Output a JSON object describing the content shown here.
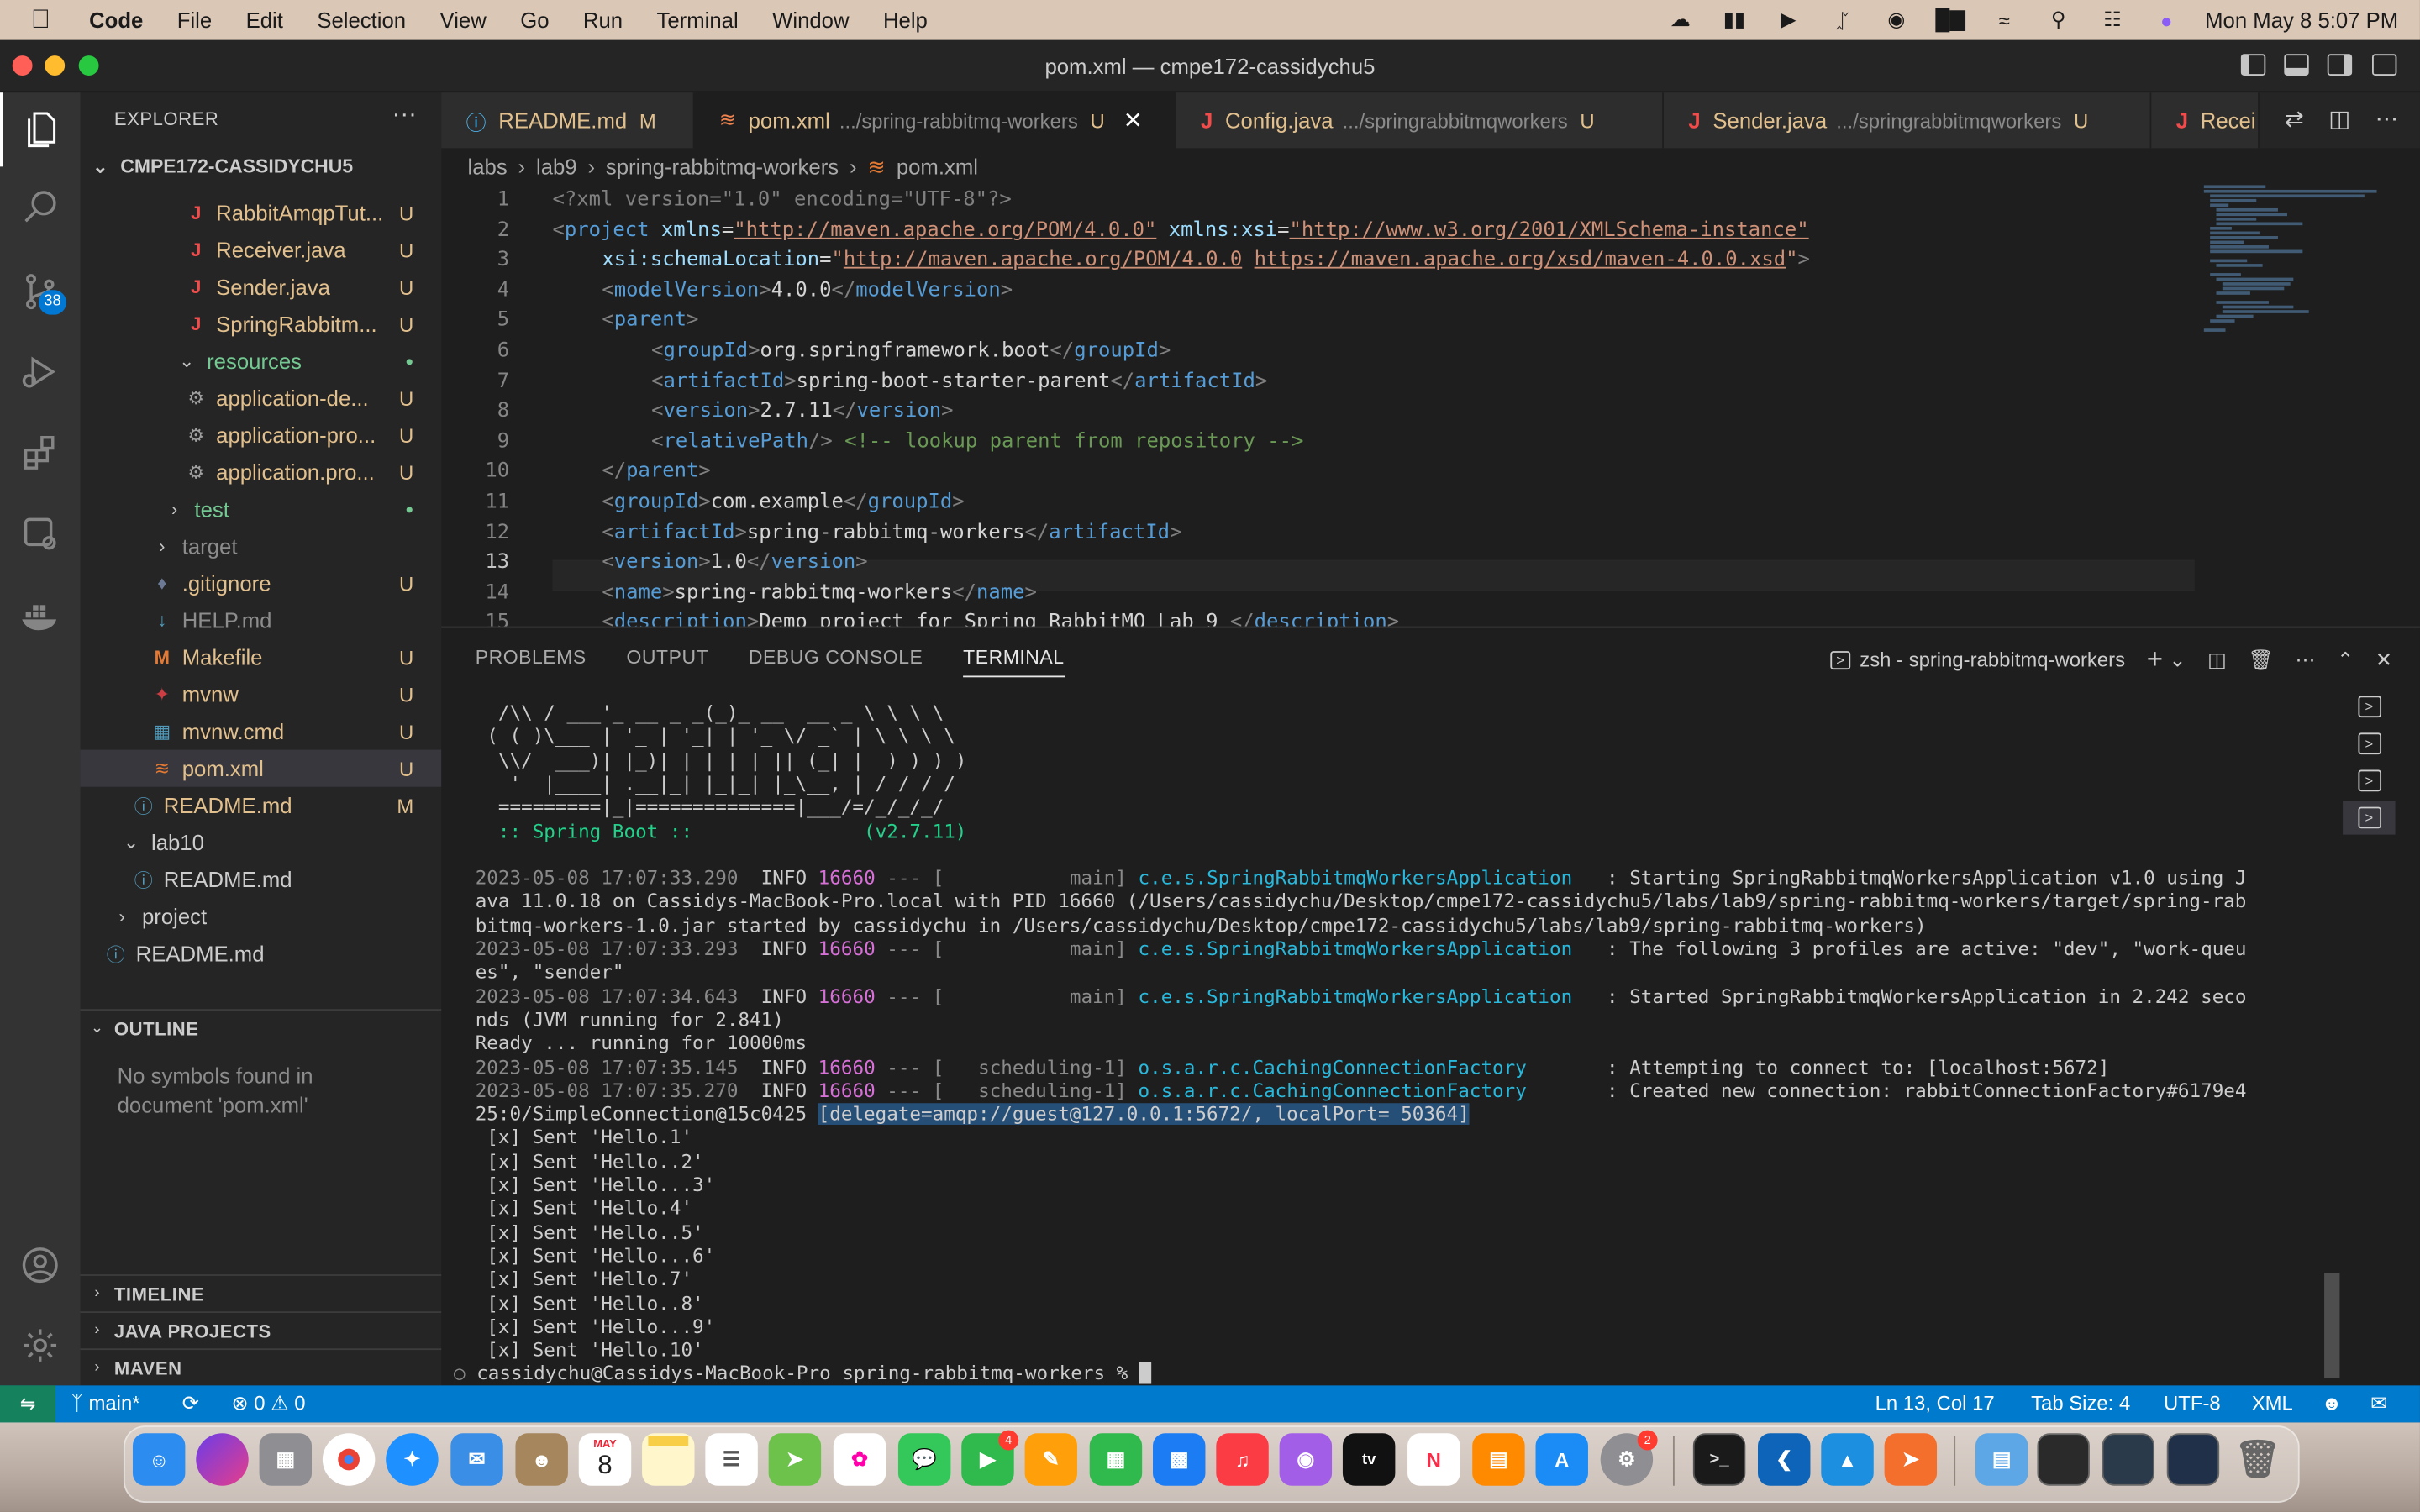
{
  "menubar": {
    "app": "Code",
    "items": [
      "File",
      "Edit",
      "Selection",
      "View",
      "Go",
      "Run",
      "Terminal",
      "Window",
      "Help"
    ],
    "datetime": "Mon May 8  5:07 PM"
  },
  "window": {
    "title": "pom.xml — cmpe172-cassidychu5"
  },
  "activity": {
    "scm_badge": "38"
  },
  "explorer": {
    "header": "EXPLORER",
    "more": "···",
    "root": "CMPE172-CASSIDYCHU5",
    "items": [
      {
        "label": "RabbitAmqpTut...",
        "badge": "U"
      },
      {
        "label": "Receiver.java",
        "badge": "U"
      },
      {
        "label": "Sender.java",
        "badge": "U"
      },
      {
        "label": "SpringRabbitm...",
        "badge": "U"
      },
      {
        "label": "resources",
        "badge": "●"
      },
      {
        "label": "application-de...",
        "badge": "U"
      },
      {
        "label": "application-pro...",
        "badge": "U"
      },
      {
        "label": "application.pro...",
        "badge": "U"
      },
      {
        "label": "test",
        "badge": "●"
      },
      {
        "label": "target",
        "badge": ""
      },
      {
        "label": ".gitignore",
        "badge": "U"
      },
      {
        "label": "HELP.md",
        "badge": ""
      },
      {
        "label": "Makefile",
        "badge": "U"
      },
      {
        "label": "mvnw",
        "badge": "U"
      },
      {
        "label": "mvnw.cmd",
        "badge": "U"
      },
      {
        "label": "pom.xml",
        "badge": "U"
      },
      {
        "label": "README.md",
        "badge": "M"
      },
      {
        "label": "lab10",
        "badge": ""
      },
      {
        "label": "README.md",
        "badge": ""
      },
      {
        "label": "project",
        "badge": ""
      },
      {
        "label": "README.md",
        "badge": ""
      }
    ],
    "outline_title": "OUTLINE",
    "outline_empty": "No symbols found in document 'pom.xml'",
    "timeline": "TIMELINE",
    "java_projects": "JAVA PROJECTS",
    "maven": "MAVEN"
  },
  "tabs": [
    {
      "name": "README.md",
      "path": "",
      "status": "M"
    },
    {
      "name": "pom.xml",
      "path": ".../spring-rabbitmq-workers",
      "status": "U"
    },
    {
      "name": "Config.java",
      "path": ".../springrabbitmqworkers",
      "status": "U"
    },
    {
      "name": "Sender.java",
      "path": ".../springrabbitmqworkers",
      "status": "U"
    },
    {
      "name": "Recei",
      "path": "",
      "status": ""
    }
  ],
  "breadcrumb": [
    "labs",
    "lab9",
    "spring-rabbitmq-workers",
    "pom.xml"
  ],
  "code_lines": [
    "1",
    "2",
    "3",
    "4",
    "5",
    "6",
    "7",
    "8",
    "9",
    "10",
    "11",
    "12",
    "13",
    "14",
    "15"
  ],
  "code": {
    "l1": [
      "<?xml version=\"1.0\" encoding=\"UTF-8\"?>"
    ],
    "l2": [
      "<",
      "project",
      " xmlns",
      "=",
      "\"http://maven.apache.org/POM/4.0.0\"",
      " xmlns:xsi",
      "=",
      "\"http://www.w3.org/2001/XMLSchema-instance\""
    ],
    "l3": [
      "xsi:schemaLocation",
      "=",
      "\"",
      "http://maven.apache.org/POM/4.0.0",
      " ",
      "https://maven.apache.org/xsd/maven-4.0.0.xsd",
      "\"",
      ">"
    ],
    "l4": [
      "<",
      "modelVersion",
      ">",
      "4.0.0",
      "</",
      "modelVersion",
      ">"
    ],
    "l5": [
      "<",
      "parent",
      ">"
    ],
    "l6": [
      "<",
      "groupId",
      ">",
      "org.springframework.boot",
      "</",
      "groupId",
      ">"
    ],
    "l7": [
      "<",
      "artifactId",
      ">",
      "spring-boot-starter-parent",
      "</",
      "artifactId",
      ">"
    ],
    "l8": [
      "<",
      "version",
      ">",
      "2.7.11",
      "</",
      "version",
      ">"
    ],
    "l9": [
      "<",
      "relativePath",
      "/>",
      " <!-- lookup parent from repository -->"
    ],
    "l10": [
      "</",
      "parent",
      ">"
    ],
    "l11": [
      "<",
      "groupId",
      ">",
      "com.example",
      "</",
      "groupId",
      ">"
    ],
    "l12": [
      "<",
      "artifactId",
      ">",
      "spring-rabbitmq-workers",
      "</",
      "artifactId",
      ">"
    ],
    "l13": [
      "<",
      "version",
      ">",
      "1.0",
      "</",
      "version",
      ">"
    ],
    "l14": [
      "<",
      "name",
      ">",
      "spring-rabbitmq-workers",
      "</",
      "name",
      ">"
    ],
    "l15": [
      "<",
      "description",
      ">",
      "Demo project for Spring RabbitMQ Lab 9 ",
      "</",
      "description",
      ">"
    ]
  },
  "panel": {
    "tabs": [
      "PROBLEMS",
      "OUTPUT",
      "DEBUG CONSOLE",
      "TERMINAL"
    ],
    "terminal_name": "zsh - spring-rabbitmq-workers"
  },
  "terminal": {
    "banner": [
      "  /\\\\ / ___'_ __ _ _(_)_ __  __ _ \\ \\ \\ \\",
      " ( ( )\\___ | '_ | '_| | '_ \\/ _` | \\ \\ \\ \\",
      "  \\\\/  ___)| |_)| | | | | || (_| |  ) ) ) )",
      "   '  |____| .__|_| |_|_| |_\\__, | / / / /",
      "  =========|_|==============|___/=/_/_/_/",
      "  :: Spring Boot ::               (v2.7.11)"
    ],
    "logs": [
      {
        "ts": "2023-05-08 17:07:33.290",
        "lvl": "INFO",
        "pid": "16660",
        "sep": "--- [",
        "thread": "           main]",
        "logger": "c.e.s.SpringRabbitmqWorkersApplication",
        "msg": "   : Starting SpringRabbitmqWorkersApplication v1.0 using J"
      },
      {
        "plain": "ava 11.0.18 on Cassidys-MacBook-Pro.local with PID 16660 (/Users/cassidychu/Desktop/cmpe172-cassidychu5/labs/lab9/spring-rabbitmq-workers/target/spring-rab"
      },
      {
        "plain": "bitmq-workers-1.0.jar started by cassidychu in /Users/cassidychu/Desktop/cmpe172-cassidychu5/labs/lab9/spring-rabbitmq-workers)"
      },
      {
        "ts": "2023-05-08 17:07:33.293",
        "lvl": "INFO",
        "pid": "16660",
        "sep": "--- [",
        "thread": "           main]",
        "logger": "c.e.s.SpringRabbitmqWorkersApplication",
        "msg": "   : The following 3 profiles are active: \"dev\", \"work-queu"
      },
      {
        "plain": "es\", \"sender\""
      },
      {
        "ts": "2023-05-08 17:07:34.643",
        "lvl": "INFO",
        "pid": "16660",
        "sep": "--- [",
        "thread": "           main]",
        "logger": "c.e.s.SpringRabbitmqWorkersApplication",
        "msg": "   : Started SpringRabbitmqWorkersApplication in 2.242 seco"
      },
      {
        "plain": "nds (JVM running for 2.841)"
      },
      {
        "plain": "Ready ... running for 10000ms"
      },
      {
        "ts": "2023-05-08 17:07:35.145",
        "lvl": "INFO",
        "pid": "16660",
        "sep": "--- [",
        "thread": "   scheduling-1]",
        "logger": "o.s.a.r.c.CachingConnectionFactory",
        "msg": "       : Attempting to connect to: [localhost:5672]"
      },
      {
        "ts": "2023-05-08 17:07:35.270",
        "lvl": "INFO",
        "pid": "16660",
        "sep": "--- [",
        "thread": "   scheduling-1]",
        "logger": "o.s.a.r.c.CachingConnectionFactory",
        "msg": "       : Created new connection: rabbitConnectionFactory#6179e4"
      }
    ],
    "conn_prefix": "25:0/SimpleConnection@15c0425 ",
    "conn_selected": "[delegate=amqp://guest@127.0.0.1:5672/, localPort= 50364]",
    "sent": [
      " [x] Sent 'Hello.1'",
      " [x] Sent 'Hello..2'",
      " [x] Sent 'Hello...3'",
      " [x] Sent 'Hello.4'",
      " [x] Sent 'Hello..5'",
      " [x] Sent 'Hello...6'",
      " [x] Sent 'Hello.7'",
      " [x] Sent 'Hello..8'",
      " [x] Sent 'Hello...9'",
      " [x] Sent 'Hello.10'"
    ],
    "prompt": "cassidychu@Cassidys-MacBook-Pro spring-rabbitmq-workers % "
  },
  "statusbar": {
    "branch": "main*",
    "errors": "0",
    "warnings": "0",
    "position": "Ln 13, Col 17",
    "tabsize": "Tab Size: 4",
    "encoding": "UTF-8",
    "language": "XML"
  },
  "dock": {
    "calendar_month": "MAY",
    "calendar_day": "8",
    "facetime_badge": "4",
    "settings_badge": "2"
  }
}
